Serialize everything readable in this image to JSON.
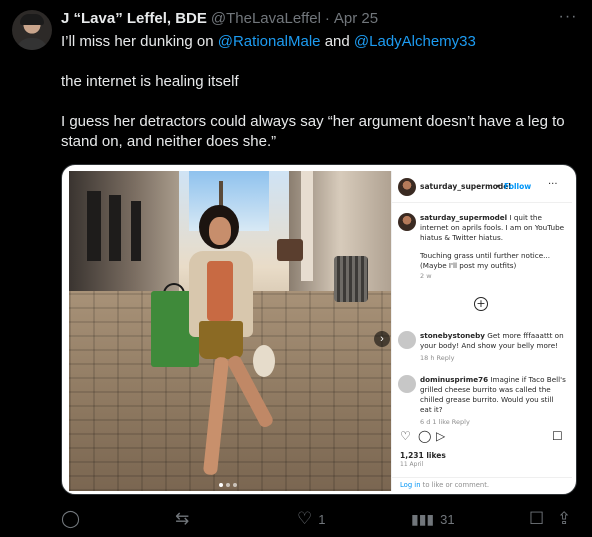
{
  "tweet": {
    "author_name": "J “Lava” Leffel, BDE",
    "handle": "@TheLavaLeffel",
    "separator": "·",
    "date": "Apr 25",
    "more_icon": "more-horizontal-icon",
    "line1_prefix": "I’ll miss her dunking on ",
    "mention1": "@RationalMale",
    "line1_and": " and ",
    "mention2": "@LadyAlchemy33",
    "line2": "the internet is healing itself",
    "line3": "I guess her detractors could always say “her argument doesn’t have a leg to stand on, and neither does she.”"
  },
  "instagram": {
    "username": "saturday_supermodel",
    "follow_separator": "•",
    "follow_label": "Follow",
    "more": "···",
    "caption_user": "saturday_supermodel",
    "caption_text": "I quit the internet on aprils fools. I am on YouTube hiatus & Twitter hiatus.",
    "caption_text2": "Touching grass until further notice... (Maybe I'll post my outfits)",
    "caption_age": "2 w",
    "comments": [
      {
        "user": "stonebystoneby",
        "text": "Get more fffaaattt on your body! And show your belly more!",
        "meta": "18 h   Reply"
      },
      {
        "user": "dominusprime76",
        "text": "Imagine if Taco Bell's grilled cheese burrito was called the chilled grease burrito. Would you still eat it?",
        "meta": "6 d   1 like   Reply"
      }
    ],
    "likes": "1,231 likes",
    "date": "11 April",
    "footer_login": "Log in",
    "footer_rest": " to like or comment."
  },
  "actions": {
    "reply_icon": "reply-icon",
    "retweet_icon": "retweet-icon",
    "like_icon": "heart-icon",
    "like_count": "1",
    "views_icon": "views-icon",
    "views_count": "31",
    "bookmark_icon": "bookmark-icon",
    "share_icon": "share-icon"
  }
}
